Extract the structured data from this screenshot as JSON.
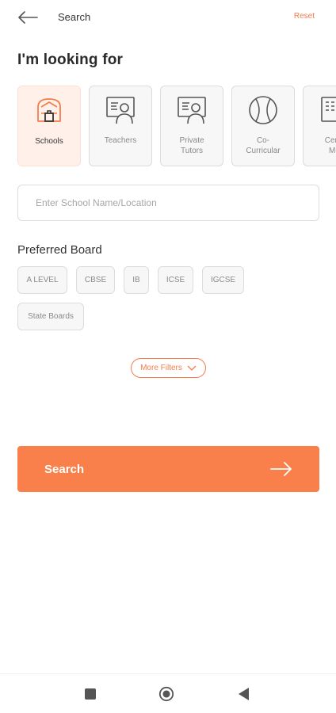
{
  "header": {
    "title": "Search",
    "reset_label": "Reset",
    "back_icon": "arrow-left-icon"
  },
  "heading": "I'm looking for",
  "categories": [
    {
      "label": "Schools",
      "icon": "school-icon",
      "active": true
    },
    {
      "label": "Teachers",
      "icon": "teacher-icon",
      "active": false
    },
    {
      "label": "Private\nTutors",
      "icon": "tutor-icon",
      "active": false
    },
    {
      "label": "Co-\nCurricular",
      "icon": "ball-icon",
      "active": false
    },
    {
      "label": "Centr\nMo",
      "icon": "center-icon",
      "active": false
    }
  ],
  "search": {
    "placeholder": "Enter School Name/Location",
    "value": ""
  },
  "preferred_board": {
    "title": "Preferred Board",
    "options": [
      "A LEVEL",
      "CBSE",
      "IB",
      "ICSE",
      "IGCSE",
      "State Boards"
    ]
  },
  "more_filters_label": "More Filters",
  "search_button_label": "Search",
  "colors": {
    "accent": "#f9804b",
    "accent_light": "#fff1ea",
    "chip_bg": "#f7f7f7",
    "border": "#dcdcdc"
  },
  "navbar": {
    "icons": [
      "square-icon",
      "home-circle-icon",
      "back-triangle-icon"
    ]
  }
}
